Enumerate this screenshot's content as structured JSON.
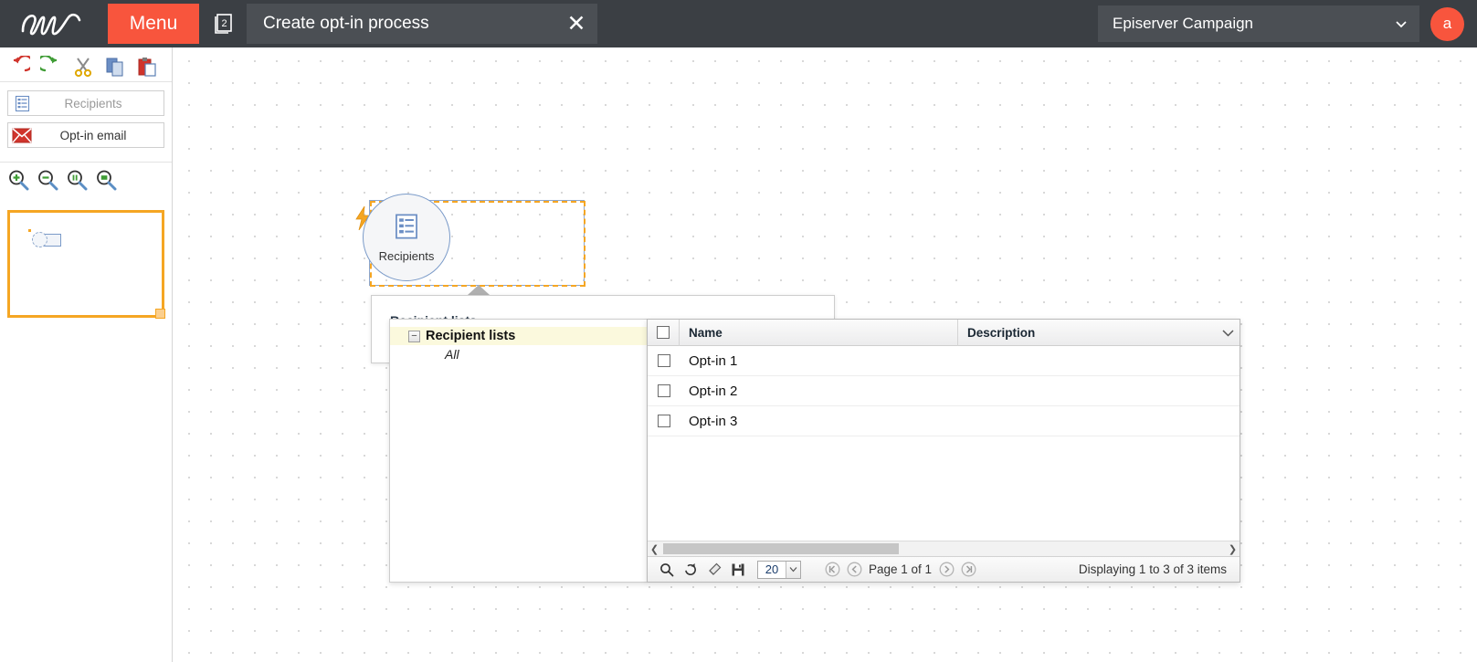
{
  "topbar": {
    "logo_icon": "episerver-logo-icon",
    "menu_label": "Menu",
    "pages_icon": "pages-stack-icon",
    "pages_badge": "2",
    "tab_title": "Create opt-in process",
    "close_icon": "close-icon",
    "org_name": "Episerver Campaign",
    "org_chevron_icon": "chevron-down-icon",
    "avatar_initial": "a"
  },
  "sidebar": {
    "edit_tools": [
      {
        "name": "undo-icon"
      },
      {
        "name": "redo-icon"
      },
      {
        "name": "cut-icon"
      },
      {
        "name": "copy-icon"
      },
      {
        "name": "paste-icon"
      }
    ],
    "palette": [
      {
        "label": "Recipients",
        "icon": "recipients-list-icon"
      },
      {
        "label": "Opt-in email",
        "icon": "envelope-icon"
      }
    ],
    "zoom_tools": [
      {
        "name": "zoom-in-icon"
      },
      {
        "name": "zoom-out-icon"
      },
      {
        "name": "zoom-fit-icon"
      },
      {
        "name": "zoom-actual-icon"
      }
    ]
  },
  "canvas": {
    "node": {
      "label": "Recipients",
      "icon": "recipients-list-icon",
      "bolt_icon": "lightning-bolt-icon"
    }
  },
  "recipient_panel": {
    "title": "Recipient lists",
    "combo_value": "",
    "combo_chevron_icon": "chevron-down-icon"
  },
  "tree": {
    "root_label": "Recipient lists",
    "expander_glyph": "−",
    "child_label": "All"
  },
  "grid": {
    "columns": [
      "Name",
      "Description"
    ],
    "header_menu_icon": "chevron-down-icon",
    "rows": [
      {
        "name": "Opt-in 1",
        "description": ""
      },
      {
        "name": "Opt-in 2",
        "description": ""
      },
      {
        "name": "Opt-in 3",
        "description": ""
      }
    ],
    "hscroll_left_icon": "chevron-left-icon",
    "hscroll_right_icon": "chevron-right-icon",
    "footer": {
      "tools": [
        {
          "name": "search-icon"
        },
        {
          "name": "refresh-icon"
        },
        {
          "name": "eraser-icon"
        },
        {
          "name": "save-floppy-icon"
        }
      ],
      "page_size": "20",
      "page_size_chevron_icon": "chevron-down-icon",
      "first_page_icon": "first-page-icon",
      "prev_page_icon": "prev-page-icon",
      "next_page_icon": "next-page-icon",
      "last_page_icon": "last-page-icon",
      "page_label": "Page 1 of 1",
      "display_info": "Displaying 1 to 3 of 3 items"
    }
  },
  "colors": {
    "brand_orange": "#f8553d",
    "topbar_bg": "#3b3f44",
    "selection_orange": "#f5a623",
    "node_blue": "#7b9bc9"
  }
}
